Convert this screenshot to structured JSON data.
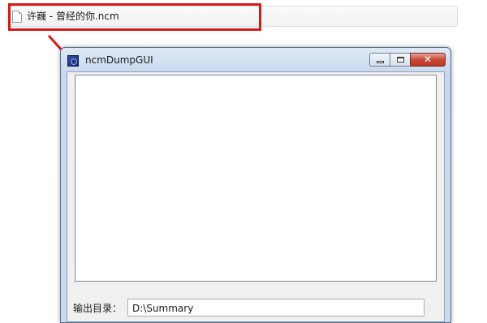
{
  "explorer": {
    "file_name": "许巍 - 曾经的你.ncm",
    "file_icon": "document-icon"
  },
  "annotation": {
    "highlight_color": "#d41a1a",
    "arrow_color": "#d41a1a"
  },
  "window": {
    "title": "ncmDumpGUI",
    "icon": "app-icon",
    "buttons": {
      "minimize": "minimize-icon",
      "maximize": "maximize-icon",
      "close": "close-icon",
      "close_glyph": "✕"
    }
  },
  "form": {
    "output_dir_label": "输出目录：",
    "output_dir_value": "D:\\Summary"
  }
}
